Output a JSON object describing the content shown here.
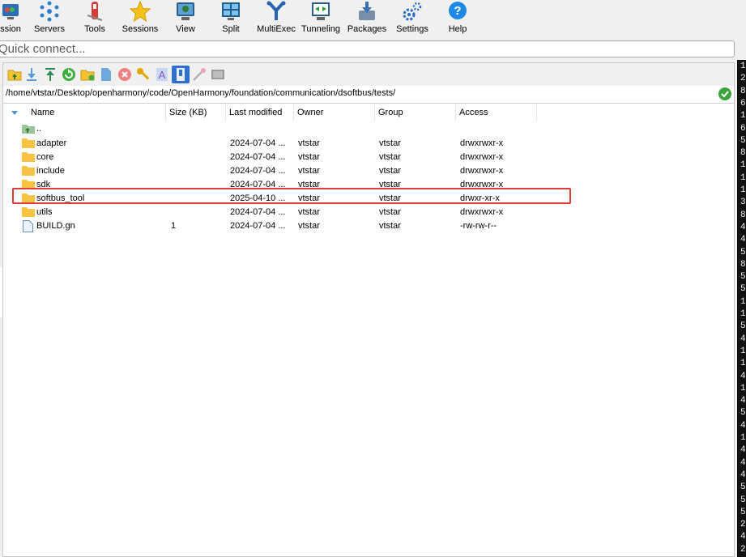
{
  "toolbar": {
    "items": [
      {
        "label": "ssion",
        "icon": "session-icon"
      },
      {
        "label": "Servers",
        "icon": "servers-icon"
      },
      {
        "label": "Tools",
        "icon": "tools-icon"
      },
      {
        "label": "Sessions",
        "icon": "star-icon"
      },
      {
        "label": "View",
        "icon": "view-icon"
      },
      {
        "label": "Split",
        "icon": "split-icon"
      },
      {
        "label": "MultiExec",
        "icon": "multiexec-icon"
      },
      {
        "label": "Tunneling",
        "icon": "tunneling-icon"
      },
      {
        "label": "Packages",
        "icon": "packages-icon"
      },
      {
        "label": "Settings",
        "icon": "gear-icon"
      },
      {
        "label": "Help",
        "icon": "help-icon"
      }
    ]
  },
  "quick_connect": {
    "placeholder": "Quick connect..."
  },
  "sftp": {
    "path": "/home/vtstar/Desktop/openharmony/code/OpenHarmony/foundation/communication/dsoftbus/tests/",
    "columns": [
      "Name",
      "Size (KB)",
      "Last modified",
      "Owner",
      "Group",
      "Access"
    ],
    "rows": [
      {
        "name": "..",
        "size": "",
        "modified": "",
        "owner": "",
        "group": "",
        "access": "",
        "type": "parent"
      },
      {
        "name": "adapter",
        "size": "",
        "modified": "2024-07-04 ...",
        "owner": "vtstar",
        "group": "vtstar",
        "access": "drwxrwxr-x",
        "type": "folder"
      },
      {
        "name": "core",
        "size": "",
        "modified": "2024-07-04 ...",
        "owner": "vtstar",
        "group": "vtstar",
        "access": "drwxrwxr-x",
        "type": "folder"
      },
      {
        "name": "include",
        "size": "",
        "modified": "2024-07-04 ...",
        "owner": "vtstar",
        "group": "vtstar",
        "access": "drwxrwxr-x",
        "type": "folder"
      },
      {
        "name": "sdk",
        "size": "",
        "modified": "2024-07-04 ...",
        "owner": "vtstar",
        "group": "vtstar",
        "access": "drwxrwxr-x",
        "type": "folder"
      },
      {
        "name": "softbus_tool",
        "size": "",
        "modified": "2025-04-10 ...",
        "owner": "vtstar",
        "group": "vtstar",
        "access": "drwxr-xr-x",
        "type": "folder"
      },
      {
        "name": "utils",
        "size": "",
        "modified": "2024-07-04 ...",
        "owner": "vtstar",
        "group": "vtstar",
        "access": "drwxrwxr-x",
        "type": "folder"
      },
      {
        "name": "BUILD.gn",
        "size": "1",
        "modified": "2024-07-04 ...",
        "owner": "vtstar",
        "group": "vtstar",
        "access": "-rw-rw-r--",
        "type": "file"
      }
    ]
  },
  "terminal_chars": [
    "1",
    "2",
    "8",
    "6",
    "1",
    "6",
    "5",
    "8",
    "1",
    "1",
    "1",
    "3",
    "8",
    "4",
    "4",
    "5",
    "8",
    "5",
    "5",
    "1",
    "1",
    "5",
    "4",
    "1",
    "1",
    "4",
    "1",
    "4",
    "5",
    "4",
    "1",
    "4",
    "4",
    "4",
    "5",
    "5",
    "5",
    "2",
    "4",
    "2"
  ]
}
